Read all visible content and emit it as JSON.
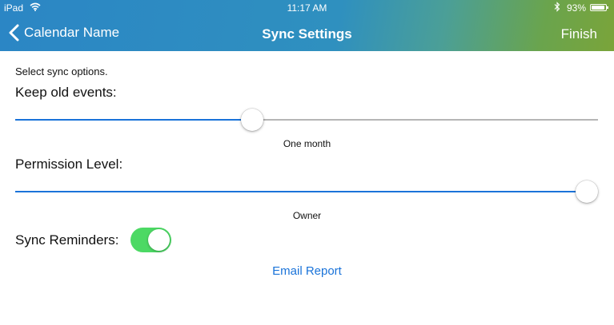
{
  "status_bar": {
    "carrier": "iPad",
    "time": "11:17 AM",
    "battery_text": "93%",
    "battery_level": 0.93,
    "wifi_icon": "wifi-icon",
    "bluetooth_icon": "bluetooth-icon"
  },
  "nav": {
    "back_label": "Calendar Name",
    "title": "Sync Settings",
    "finish_label": "Finish"
  },
  "hint": "Select sync options.",
  "keep_old_events": {
    "label": "Keep old events:",
    "value_label": "One month",
    "level": 0.403
  },
  "permission_level": {
    "label": "Permission Level:",
    "value_label": "Owner",
    "level": 1.0
  },
  "sync_reminders": {
    "label": "Sync Reminders:",
    "on": true
  },
  "email_report_label": "Email Report",
  "colors": {
    "accent": "#1a73d9",
    "toggle_on": "#4cd964"
  }
}
